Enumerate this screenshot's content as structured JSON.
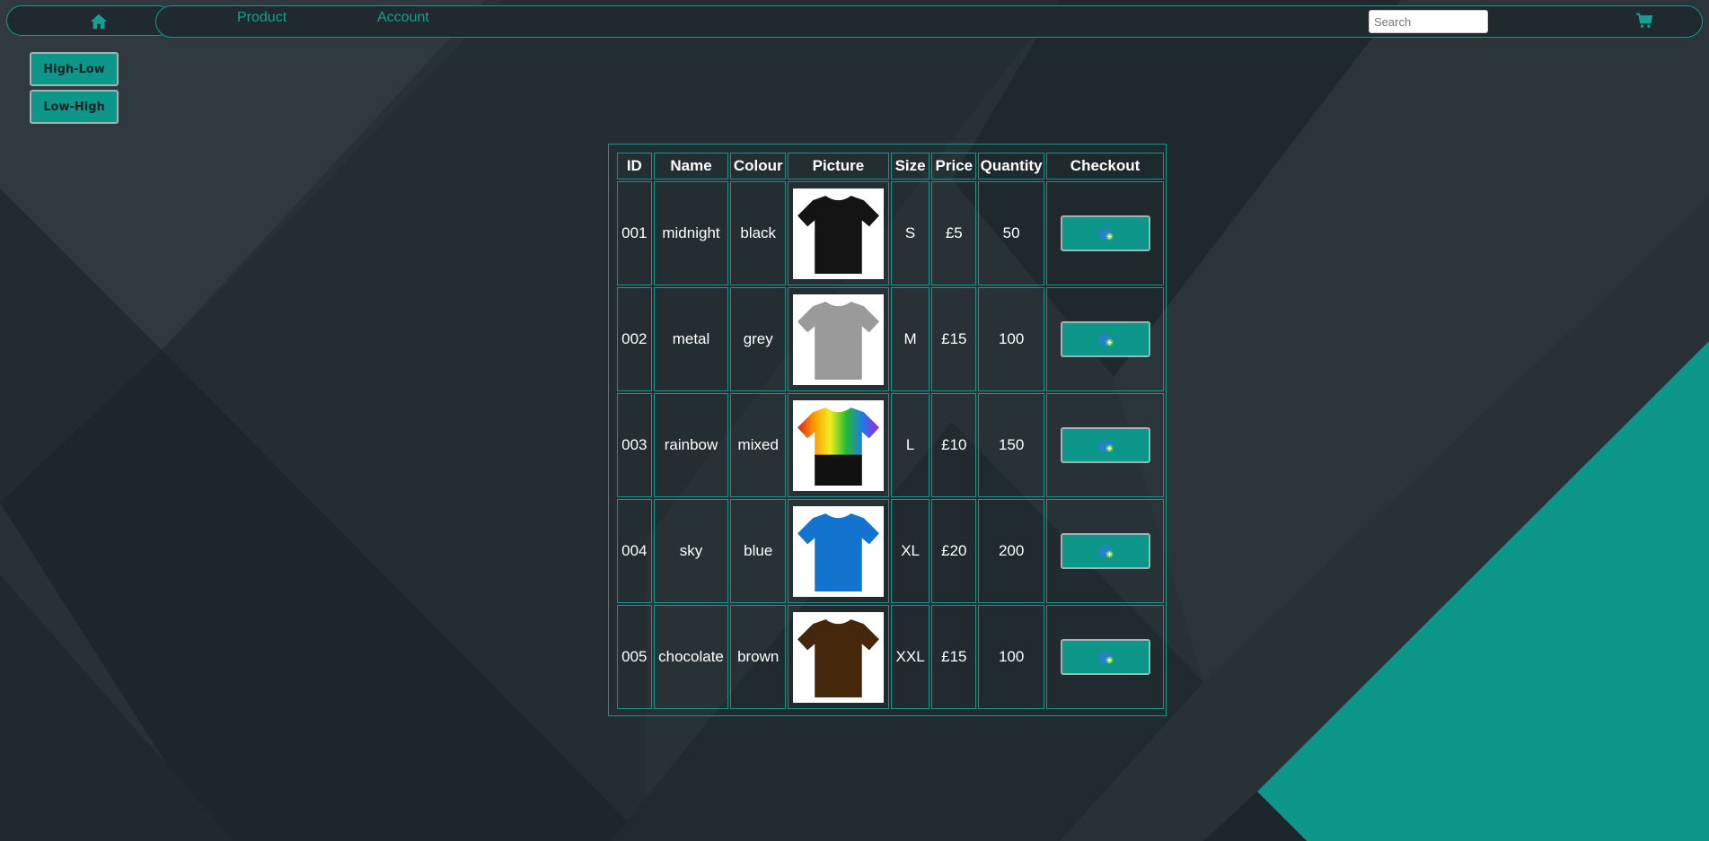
{
  "colors": {
    "accent": "#0d968a",
    "background": "#283136",
    "nav_background": "#1f292e",
    "text": "#ffffff"
  },
  "nav": {
    "home_icon": "home-icon",
    "links": [
      "Product",
      "Account"
    ],
    "search_placeholder": "Search",
    "cart_icon": "cart-icon"
  },
  "sort": {
    "high_low": "High-Low",
    "low_high": "Low-High"
  },
  "table": {
    "headers": [
      "ID",
      "Name",
      "Colour",
      "Picture",
      "Size",
      "Price",
      "Quantity",
      "Checkout"
    ],
    "rows": [
      {
        "id": "001",
        "name": "midnight",
        "colour": "black",
        "size": "S",
        "price": "£5",
        "quantity": "50",
        "shirt_color": "#141414"
      },
      {
        "id": "002",
        "name": "metal",
        "colour": "grey",
        "size": "M",
        "price": "£15",
        "quantity": "100",
        "shirt_color": "#9a9a9a"
      },
      {
        "id": "003",
        "name": "rainbow",
        "colour": "mixed",
        "size": "L",
        "price": "£10",
        "quantity": "150",
        "shirt_color": "rainbow"
      },
      {
        "id": "004",
        "name": "sky",
        "colour": "blue",
        "size": "XL",
        "price": "£20",
        "quantity": "200",
        "shirt_color": "#1274cf"
      },
      {
        "id": "005",
        "name": "chocolate",
        "colour": "brown",
        "size": "XXL",
        "price": "£15",
        "quantity": "100",
        "shirt_color": "#45280c"
      }
    ],
    "add_button_icon": "basket-add-icon"
  }
}
